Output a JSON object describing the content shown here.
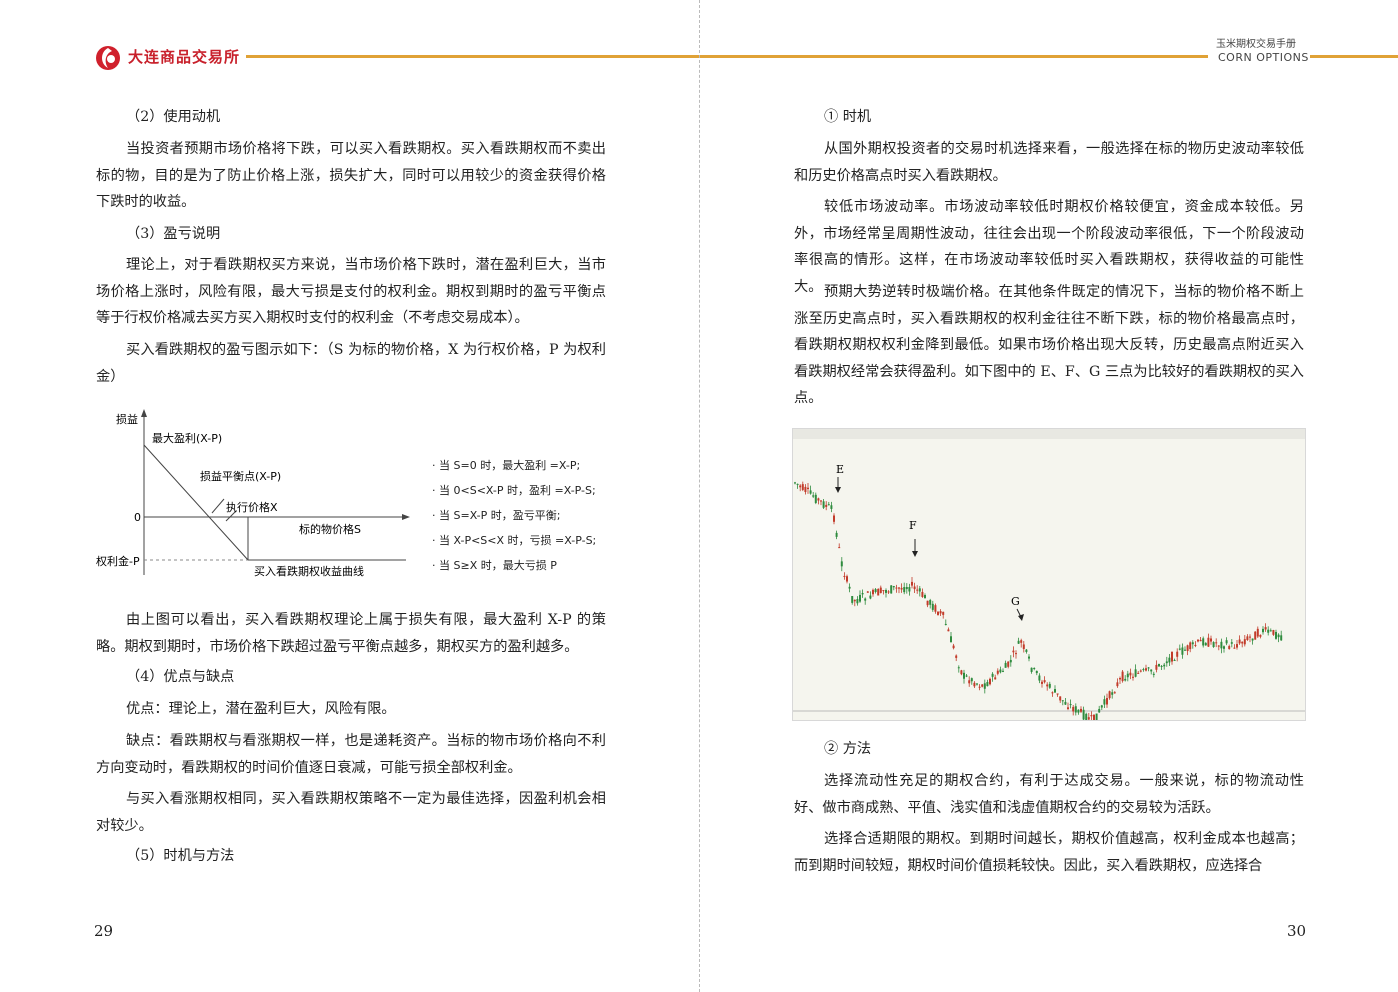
{
  "header": {
    "brand": "大连商品交易所",
    "right_title": "玉米期权交易手册",
    "right_subtitle": "CORN OPTIONS"
  },
  "left": {
    "h1": "（2）使用动机",
    "p1": "当投资者预期市场价格将下跌，可以买入看跌期权。买入看跌期权而不卖出标的物，目的是为了防止价格上涨，损失扩大，同时可以用较少的资金获得价格下跌时的收益。",
    "h2": "（3）盈亏说明",
    "p2": "理论上，对于看跌期权买方来说，当市场价格下跌时，潜在盈利巨大，当市场价格上涨时，风险有限，最大亏损是支付的权利金。期权到期时的盈亏平衡点等于行权价格减去买方买入期权时支付的权利金（不考虑交易成本）。",
    "p3": "买入看跌期权的盈亏图示如下：（S 为标的物价格，X 为行权价格，P 为权利金）",
    "diagram": {
      "y_label": "损益",
      "max_profit": "最大盈利(X-P)",
      "breakeven": "损益平衡点(X-P)",
      "strike": "执行价格X",
      "zero": "0",
      "underlying": "标的物价格S",
      "premium": "权利金-P",
      "curve": "买入看跌期权收益曲线",
      "notes": [
        "当 S=0 时，最大盈利 =X-P;",
        "当 0<S<X-P 时，盈利 =X-P-S;",
        "当 S=X-P 时，盈亏平衡;",
        "当 X-P<S<X 时，亏损 =X-P-S;",
        "当 S≥X 时，最大亏损 P"
      ]
    },
    "p4": "由上图可以看出，买入看跌期权理论上属于损失有限，最大盈利 X-P 的策略。期权到期时，市场价格下跌超过盈亏平衡点越多，期权买方的盈利越多。",
    "h3": "（4）优点与缺点",
    "p5": "优点：理论上，潜在盈利巨大，风险有限。",
    "p6": "缺点：看跌期权与看涨期权一样，也是递耗资产。当标的物市场价格向不利方向变动时，看跌期权的时间价值逐日衰减，可能亏损全部权利金。",
    "p7": "与买入看涨期权相同，买入看跌期权策略不一定为最佳选择，因盈利机会相对较少。",
    "h4": "（5）时机与方法",
    "page_number": "29"
  },
  "right": {
    "h1": "① 时机",
    "p1": "从国外期权投资者的交易时机选择来看，一般选择在标的物历史波动率较低和历史价格高点时买入看跌期权。",
    "p2": "较低市场波动率。市场波动率较低时期权价格较便宜，资金成本较低。另外，市场经常呈周期性波动，往往会出现一个阶段波动率很低，下一个阶段波动率很高的情形。这样，在市场波动率较低时买入看跌期权，获得收益的可能性大。",
    "p3": "预期大势逆转时极端价格。在其他条件既定的情况下，当标的物价格不断上涨至历史高点时，买入看跌期权的权利金往往不断下跌，标的物价格最高点时，看跌期权期权权利金降到最低。如果市场价格出现大反转，历史最高点附近买入看跌期权经常会获得盈利。如下图中的 E、F、G 三点为比较好的看跌期权的买入点。",
    "chart_labels": {
      "e": "E",
      "f": "F",
      "g": "G"
    },
    "h2": "② 方法",
    "p4": "选择流动性充足的期权合约，有利于达成交易。一般来说，标的物流动性好、做市商成熟、平值、浅实值和浅虚值期权合约的交易较为活跃。",
    "p5": "选择合适期限的期权。到期时间越长，期权价值越高，权利金成本也越高；而到期时间较短，期权时间价值损耗较快。因此，买入看跌期权，应选择合",
    "page_number": "30"
  }
}
